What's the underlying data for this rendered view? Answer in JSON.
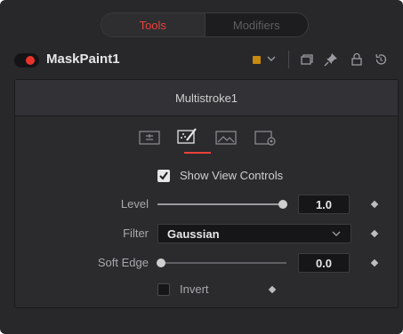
{
  "tabs": [
    {
      "label": "Tools",
      "active": true
    },
    {
      "label": "Modifiers",
      "active": false
    }
  ],
  "header": {
    "node_name": "MaskPaint1",
    "swatch_color": "#c98a0f",
    "icons": [
      "enable-toggle-icon",
      "color-swatch-icon",
      "chevron-down-icon",
      "versions-icon",
      "pin-icon",
      "lock-icon",
      "reset-icon"
    ]
  },
  "content": {
    "title": "Multistroke1",
    "inspector_tabs": [
      {
        "icon": "controls-tab-icon",
        "active": false
      },
      {
        "icon": "paint-brush-tab-icon",
        "active": true
      },
      {
        "icon": "image-tab-icon",
        "active": false
      },
      {
        "icon": "settings-tab-icon",
        "active": false
      }
    ],
    "show_view_controls": {
      "label": "Show View Controls",
      "checked": true
    },
    "level": {
      "label": "Level",
      "value": "1.0",
      "fraction": 1.0
    },
    "filter": {
      "label": "Filter",
      "value": "Gaussian"
    },
    "soft_edge": {
      "label": "Soft Edge",
      "value": "0.0",
      "fraction": 0.0
    },
    "invert": {
      "label": "Invert",
      "checked": false
    }
  },
  "colors": {
    "accent": "#e8423a",
    "toggle_on": "#e8332b",
    "panel_bg": "#28282b"
  }
}
